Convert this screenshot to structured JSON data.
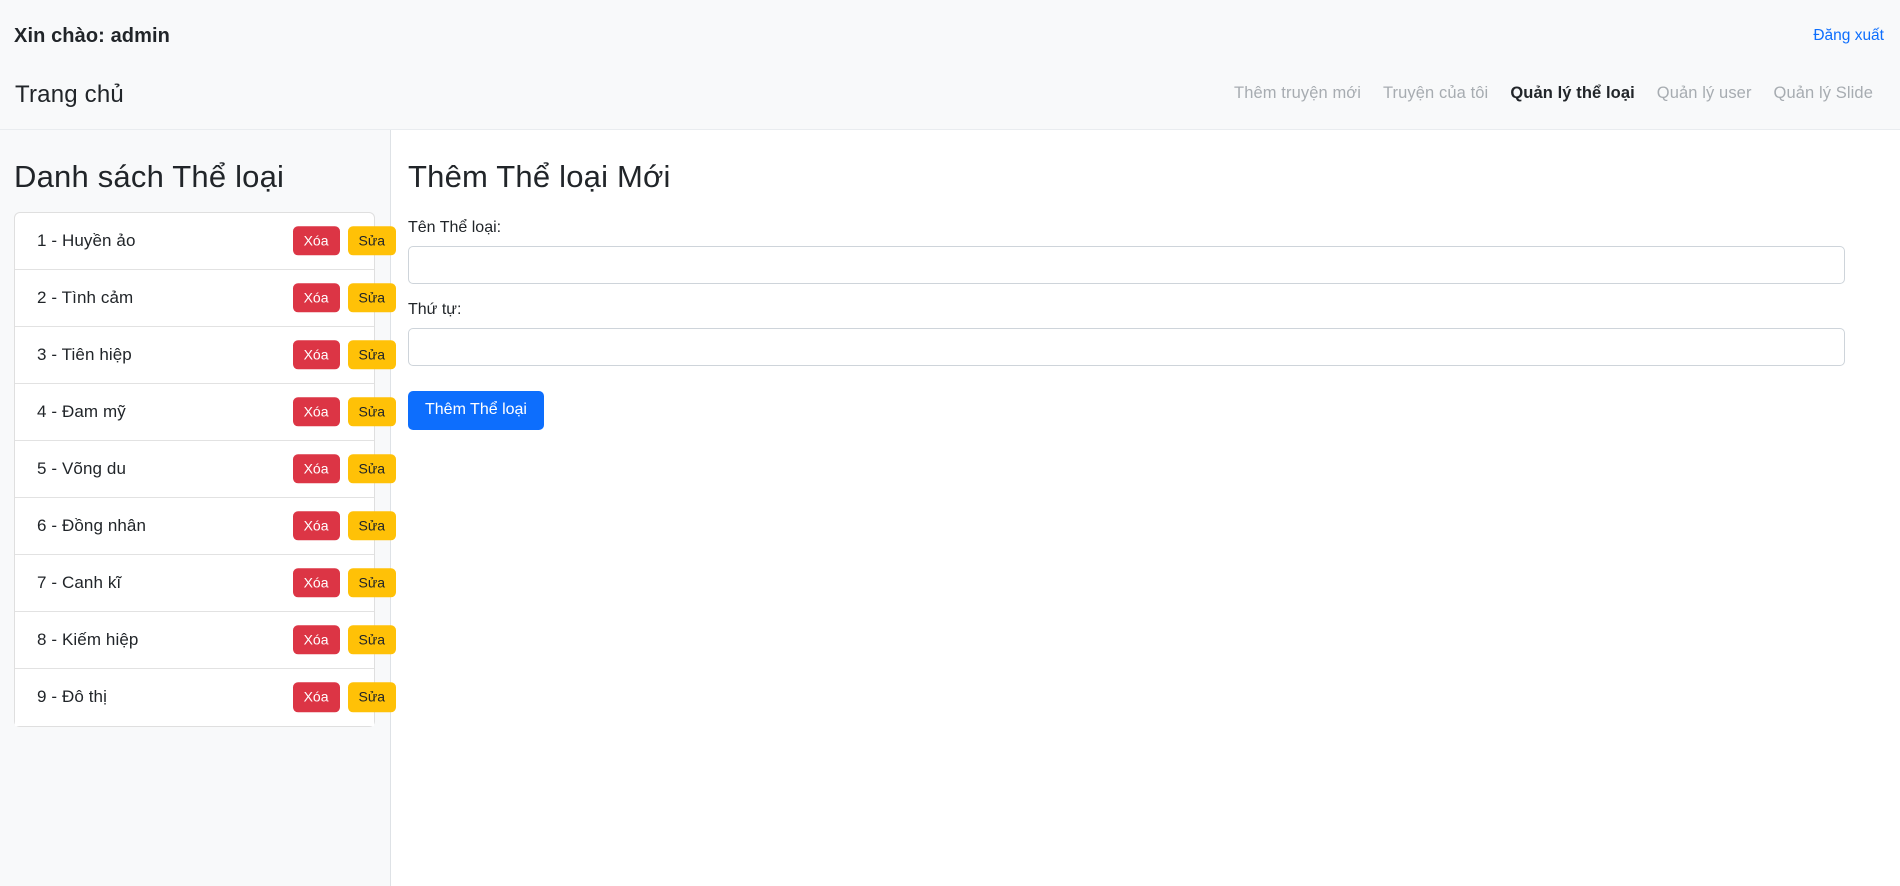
{
  "header": {
    "greeting": "Xin chào: admin",
    "logout_label": "Đăng xuất",
    "brand": "Trang chủ",
    "nav": [
      {
        "label": "Thêm truyện mới",
        "active": false
      },
      {
        "label": "Truyện của tôi",
        "active": false
      },
      {
        "label": "Quản lý thể loại",
        "active": true
      },
      {
        "label": "Quản lý user",
        "active": false
      },
      {
        "label": "Quản lý Slide",
        "active": false
      }
    ]
  },
  "sidebar": {
    "title": "Danh sách Thể loại",
    "delete_label": "Xóa",
    "edit_label": "Sửa",
    "categories": [
      {
        "id": "1",
        "name": "Huyền ảo",
        "label": "1 - Huyền ảo"
      },
      {
        "id": "2",
        "name": "Tình cảm",
        "label": "2 - Tình cảm"
      },
      {
        "id": "3",
        "name": "Tiên hiệp",
        "label": "3 - Tiên hiệp"
      },
      {
        "id": "4",
        "name": "Đam mỹ",
        "label": "4 - Đam mỹ"
      },
      {
        "id": "5",
        "name": "Võng du",
        "label": "5 - Võng du"
      },
      {
        "id": "6",
        "name": "Đồng nhân",
        "label": "6 - Đồng nhân"
      },
      {
        "id": "7",
        "name": "Canh kĩ",
        "label": "7 - Canh kĩ"
      },
      {
        "id": "8",
        "name": "Kiếm hiệp",
        "label": "8 - Kiếm hiệp"
      },
      {
        "id": "9",
        "name": "Đô thị",
        "label": "9 - Đô thị"
      }
    ]
  },
  "main": {
    "title": "Thêm Thể loại Mới",
    "fields": {
      "name": {
        "label": "Tên Thể loại:",
        "value": "",
        "placeholder": ""
      },
      "order": {
        "label": "Thứ tự:",
        "value": "",
        "placeholder": ""
      }
    },
    "submit_label": "Thêm Thể loại"
  },
  "colors": {
    "primary": "#0d6efd",
    "danger": "#dc3545",
    "warning": "#ffc107",
    "surface": "#f8f9fa",
    "link": "#0d6efd"
  }
}
